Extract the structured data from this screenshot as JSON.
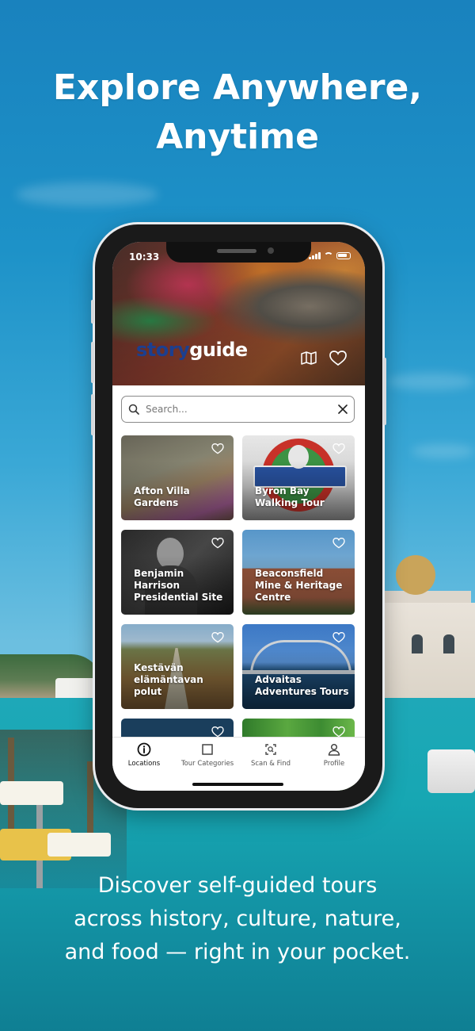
{
  "headline": {
    "line1": "Explore Anywhere,",
    "line2": "Anytime"
  },
  "subtext": {
    "line1": "Discover self-guided tours",
    "line2": "across history, culture, nature,",
    "line3": "and food — right in your pocket."
  },
  "phone": {
    "status_time": "10:33",
    "logo_part1": "story",
    "logo_part2": "guide",
    "hero_icons": [
      "map-icon",
      "heart-icon"
    ],
    "search": {
      "placeholder": "Search...",
      "value": ""
    },
    "cards": [
      {
        "title": "Afton Villa Gardens",
        "theme": "garden"
      },
      {
        "title": "Byron Bay Walking Tour",
        "theme": "byron"
      },
      {
        "title": "Benjamin Harrison Presidential Site",
        "theme": "portrait"
      },
      {
        "title": "Beaconsfield Mine & Heritage Centre",
        "theme": "heritage"
      },
      {
        "title": "Kestävän elämäntavan polut",
        "theme": "boardwalk"
      },
      {
        "title": "Advaitas Adventures Tours",
        "theme": "bridge"
      },
      {
        "title": "",
        "theme": "navy"
      },
      {
        "title": "",
        "theme": "greens"
      }
    ],
    "tabs": [
      {
        "label": "Locations",
        "icon": "info-icon",
        "active": true
      },
      {
        "label": "Tour Categories",
        "icon": "square-icon",
        "active": false
      },
      {
        "label": "Scan & Find",
        "icon": "scan-icon",
        "active": false
      },
      {
        "label": "Profile",
        "icon": "person-icon",
        "active": false
      }
    ]
  },
  "colors": {
    "sky": "#1d92c8",
    "sea": "#17a7b3",
    "logo_blue": "#1c3f8f"
  }
}
